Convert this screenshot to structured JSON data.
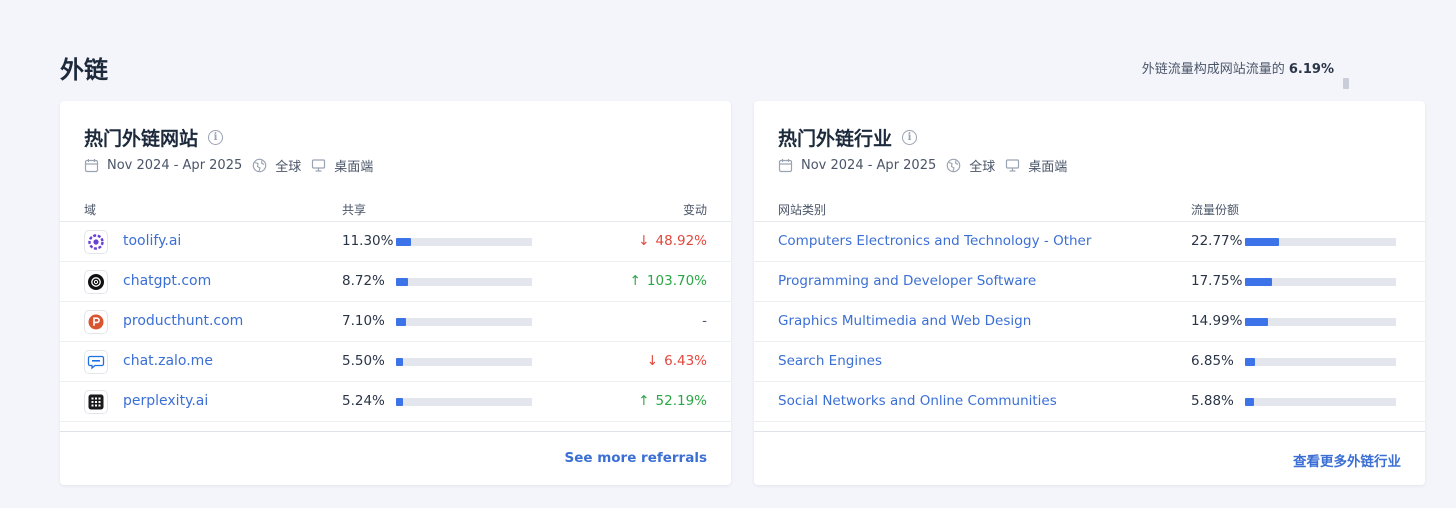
{
  "section": {
    "title": "外链",
    "summary_prefix": "外链流量构成网站流量的",
    "summary_value": "6.19%"
  },
  "referrals_card": {
    "title": "热门外链网站",
    "date_range": "Nov 2024 - Apr 2025",
    "region": "全球",
    "device": "桌面端",
    "columns": {
      "domain": "域",
      "share": "共享",
      "change": "变动"
    },
    "rows": [
      {
        "icon": "toolify-icon",
        "domain": "toolify.ai",
        "share": "11.30%",
        "share_value": 11.3,
        "direction": "down",
        "arrow": "↓",
        "change": "48.92%"
      },
      {
        "icon": "chatgpt-icon",
        "domain": "chatgpt.com",
        "share": "8.72%",
        "share_value": 8.72,
        "direction": "up",
        "arrow": "↑",
        "change": "103.70%"
      },
      {
        "icon": "producthunt-icon",
        "domain": "producthunt.com",
        "share": "7.10%",
        "share_value": 7.1,
        "direction": "neutral",
        "arrow": "",
        "change": "-"
      },
      {
        "icon": "zalo-icon",
        "domain": "chat.zalo.me",
        "share": "5.50%",
        "share_value": 5.5,
        "direction": "down",
        "arrow": "↓",
        "change": "6.43%"
      },
      {
        "icon": "perplexity-icon",
        "domain": "perplexity.ai",
        "share": "5.24%",
        "share_value": 5.24,
        "direction": "up",
        "arrow": "↑",
        "change": "52.19%"
      }
    ],
    "more_label": "See more referrals"
  },
  "industries_card": {
    "title": "热门外链行业",
    "date_range": "Nov 2024 - Apr 2025",
    "region": "全球",
    "device": "桌面端",
    "columns": {
      "category": "网站类别",
      "share": "流量份额"
    },
    "rows": [
      {
        "category": "Computers Electronics and Technology - Other",
        "share": "22.77%",
        "share_value": 22.77
      },
      {
        "category": "Programming and Developer Software",
        "share": "17.75%",
        "share_value": 17.75
      },
      {
        "category": "Graphics Multimedia and Web Design",
        "share": "14.99%",
        "share_value": 14.99
      },
      {
        "category": "Search Engines",
        "share": "6.85%",
        "share_value": 6.85
      },
      {
        "category": "Social Networks and Online Communities",
        "share": "5.88%",
        "share_value": 5.88
      }
    ],
    "more_label": "查看更多外链行业"
  },
  "colors": {
    "link": "#3b6fd4",
    "bar_fill": "#3c73e9",
    "bar_track": "#e3e6ec",
    "up": "#2aa744",
    "down": "#e2483d"
  }
}
